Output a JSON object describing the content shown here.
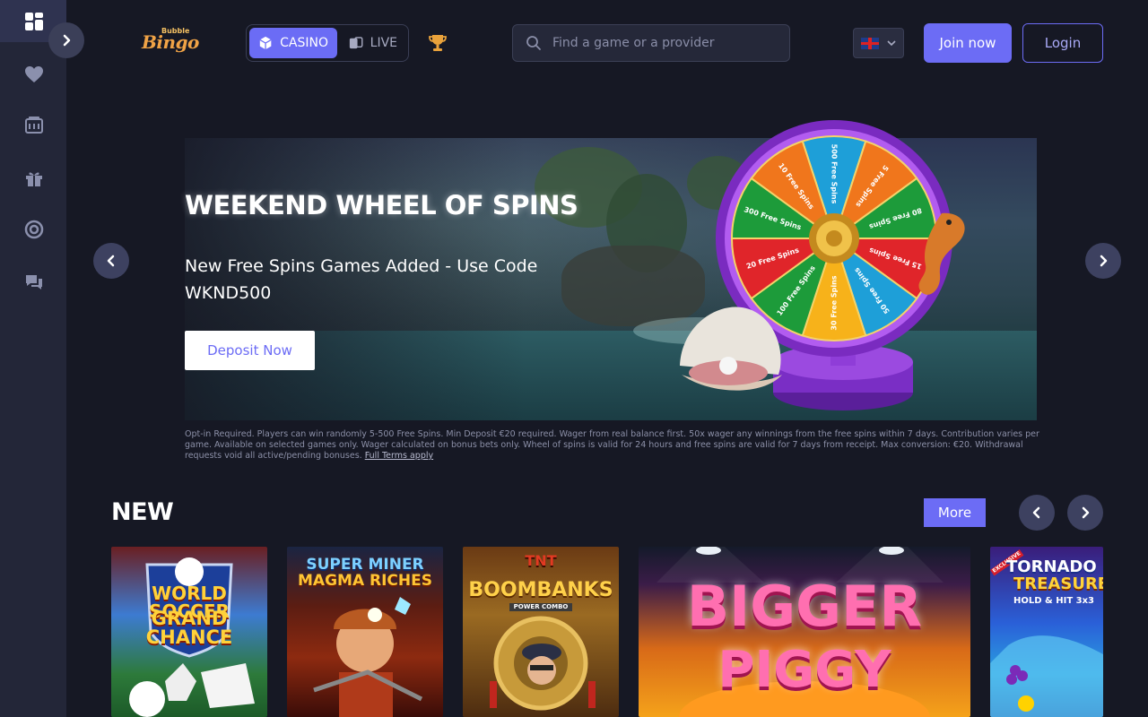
{
  "sidebar": {
    "items": [
      {
        "name": "dashboard",
        "icon": "dashboard-icon"
      },
      {
        "name": "favorites",
        "icon": "heart-icon"
      },
      {
        "name": "casino",
        "icon": "casino-icon"
      },
      {
        "name": "promotions",
        "icon": "gift-icon"
      },
      {
        "name": "support",
        "icon": "lifebuoy-icon"
      },
      {
        "name": "help",
        "icon": "help-chat-icon"
      }
    ]
  },
  "header": {
    "logo_small": "Bubble",
    "logo_big": "Bingo",
    "tabs": [
      {
        "label": "CASINO",
        "active": true
      },
      {
        "label": "LIVE",
        "active": false
      }
    ],
    "search_placeholder": "Find a game or a provider",
    "join_label": "Join now",
    "login_label": "Login"
  },
  "banner": {
    "title": "WEEKEND WHEEL OF SPINS",
    "subtitle": "New Free Spins Games Added - Use Code WKND500",
    "cta": "Deposit Now",
    "wheel_segments": [
      "500 Free Spins",
      "5 Free Spins",
      "80 Free Spins",
      "15 Free Spins",
      "50 Free Spins",
      "30 Free Spins",
      "100 Free Spins",
      "20 Free Spins",
      "300 Free Spins",
      "10 Free Spins"
    ]
  },
  "terms": {
    "text": "Opt-in Required. Players can win randomly 5-500 Free Spins. Min Deposit €20 required. Wager from real balance first. 50x wager any winnings from the free spins within 7 days. Contribution varies per game. Available on selected games only. Wager calculated on bonus bets only. Wheel of spins is valid for 24 hours and free spins are valid for 7 days from receipt. Max conversion: €20. Withdrawal requests void all active/pending bonuses.",
    "link": "Full Terms apply"
  },
  "new_section": {
    "title": "NEW",
    "more_label": "More",
    "games": [
      {
        "line1": "WORLD SOCCER",
        "line2": "GRAND CHANCE"
      },
      {
        "line1": "SUPER MINER",
        "line2": "MAGMA RICHES"
      },
      {
        "line1": "TNT",
        "line2": "BOOMBANKS",
        "line3": "POWER COMBO"
      },
      {
        "line1": "BIGGER",
        "line2": "PIGGY"
      },
      {
        "badge": "EXCLUSIVE",
        "line1": "TORNADO",
        "line2": "TREASURE",
        "line3": "HOLD & HIT 3x3"
      }
    ]
  },
  "colors": {
    "accent": "#6c6cf5",
    "background": "#161824",
    "sidebar": "#232638"
  }
}
